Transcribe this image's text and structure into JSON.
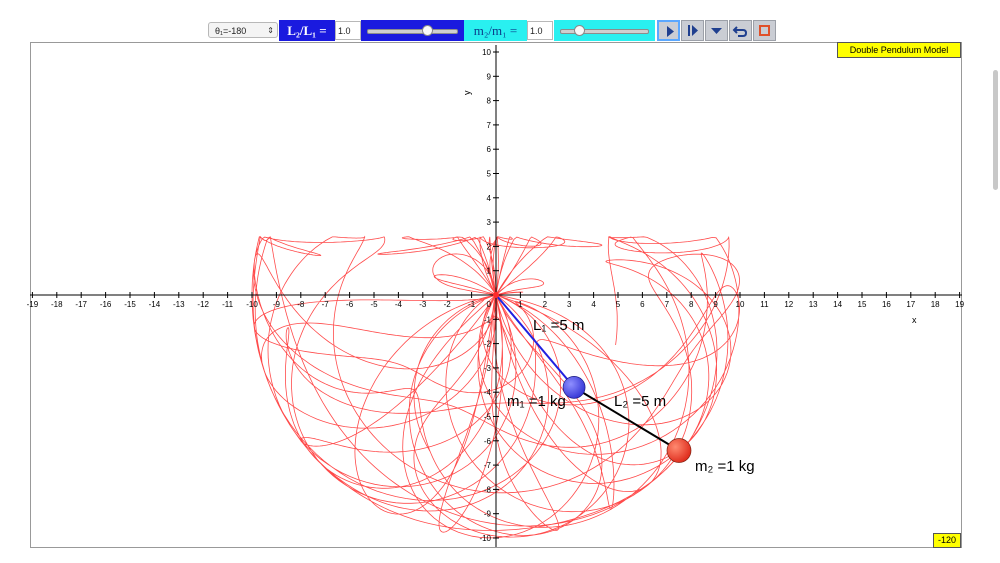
{
  "toolbar": {
    "theta_select": {
      "label": "θ₁=-180"
    },
    "length_ratio": {
      "label": "L₂/L₁ =",
      "value": "1.0",
      "slider_fraction": 0.66
    },
    "mass_ratio": {
      "label": "m₂/m₁ =",
      "value": "1.0",
      "slider_fraction": 0.22
    },
    "buttons": [
      {
        "name": "play-button",
        "icon": "play-icon"
      },
      {
        "name": "step-button",
        "icon": "step-forward-icon"
      },
      {
        "name": "menu-button",
        "icon": "chevron-down-icon"
      },
      {
        "name": "reset-button",
        "icon": "undo-icon"
      },
      {
        "name": "stop-button",
        "icon": "stop-icon"
      }
    ]
  },
  "panel": {
    "title": "Double Pendulum Model",
    "readout": "-120"
  },
  "plot": {
    "x_axis_label": "x",
    "y_axis_label": "y",
    "x_range": [
      -19,
      19
    ],
    "y_range": [
      -10,
      10
    ],
    "colors": {
      "trace": "#ff2a2a",
      "rod1": "#2020e0",
      "rod2": "#000000",
      "mass1": "#3b3bd8",
      "mass2": "#e03020"
    },
    "pendulum": {
      "pivot": [
        0,
        0
      ],
      "mass1_position": [
        3.2,
        -3.8
      ],
      "mass2_position": [
        7.5,
        -6.4
      ],
      "annotations": {
        "L1": "L₁ =5 m",
        "m1": "m₁ =1 kg",
        "L2": "L₂ =5 m",
        "m2": "m₂ =1 kg"
      }
    }
  }
}
